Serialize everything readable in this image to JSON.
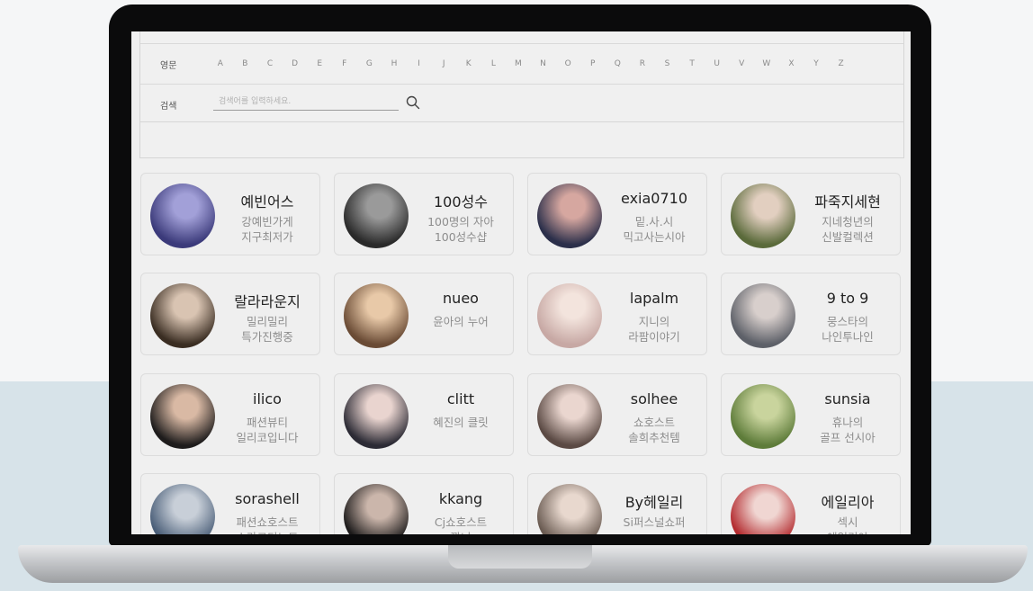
{
  "filter": {
    "alphabet_label": "영문",
    "letters": [
      "A",
      "B",
      "C",
      "D",
      "E",
      "F",
      "G",
      "H",
      "I",
      "J",
      "K",
      "L",
      "M",
      "N",
      "O",
      "P",
      "Q",
      "R",
      "S",
      "T",
      "U",
      "V",
      "W",
      "X",
      "Y",
      "Z"
    ],
    "search_label": "검색",
    "search_placeholder": "검색어를 입력하세요."
  },
  "creators": [
    {
      "name": "예빈어스",
      "desc": "강예빈가게\n지구최저가"
    },
    {
      "name": "100성수",
      "desc": "100명의 자아\n100성수샵"
    },
    {
      "name": "exia0710",
      "desc": "밑.사.시\n믹고사는시아"
    },
    {
      "name": "파죽지세현",
      "desc": "지네청년의\n신발컬렉션"
    },
    {
      "name": "랄라라운지",
      "desc": "밀리밀리\n특가진행중"
    },
    {
      "name": "nueo",
      "desc": "윤아의 누어"
    },
    {
      "name": "lapalm",
      "desc": "지니의\n라팜이야기"
    },
    {
      "name": "9 to 9",
      "desc": "뭉스타의\n나인투나인"
    },
    {
      "name": "ilico",
      "desc": "패션뷰티\n일리코입니다"
    },
    {
      "name": "clitt",
      "desc": "혜진의 클릿"
    },
    {
      "name": "solhee",
      "desc": "쇼호스트\n솔희추천템"
    },
    {
      "name": "sunsia",
      "desc": "휴나의\n골프 선시아"
    },
    {
      "name": "sorashell",
      "desc": "패션쇼호스트\n소라코디노트"
    },
    {
      "name": "kkang",
      "desc": "Cj쇼호스트\n깡니"
    },
    {
      "name": "By헤일리",
      "desc": "Si퍼스널쇼퍼"
    },
    {
      "name": "에일리아",
      "desc": "섹시\n에일리아"
    }
  ]
}
